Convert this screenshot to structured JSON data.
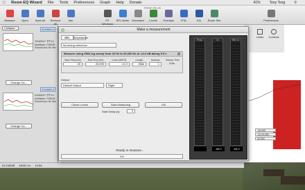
{
  "menubar": {
    "app": "Room EQ Wizard",
    "items": [
      "File",
      "Tools",
      "Preferences",
      "Graph",
      "Help",
      "Donate"
    ],
    "status": "Tony Teng",
    "battery": "41%"
  },
  "toolbar": {
    "title": "REW V5.18",
    "buttons": [
      {
        "label": "Measure",
        "color": "#d44"
      },
      {
        "label": "Open",
        "color": "#4a79c4"
      },
      {
        "label": "Save All",
        "color": "#4a79c4"
      },
      {
        "label": "Remove All",
        "color": "#c44"
      },
      {
        "label": "Info",
        "color": "#4a79c4"
      }
    ],
    "right": [
      {
        "label": "RT Windows",
        "color": "#555"
      },
      {
        "label": "SPL Meter",
        "color": "#3a7ed4"
      },
      {
        "label": "Generator",
        "color": "#888"
      },
      {
        "label": "Levels",
        "color": "#3a8a3a"
      },
      {
        "label": "Overlays",
        "color": "#6a6a9a"
      },
      {
        "label": "RTA",
        "color": "#3a6ac4"
      },
      {
        "label": "EQ",
        "color": "#2a5aa4"
      },
      {
        "label": "Room Sim",
        "color": "#4a8a6a"
      },
      {
        "label": "Preferences",
        "color": "#777"
      }
    ]
  },
  "left": {
    "collapse": "Collapse",
    "measurements": [
      {
        "date": "20180813",
        "info": [
          "2018/8/12 下午10:",
          "Mic/Meter: PSENR",
          "SoundCard: No Mic"
        ],
        "button": "Change Ca..."
      },
      {
        "date": "20180813",
        "info": [
          "2018/8/13 下午10:",
          "Mic/Meter: PSENR",
          "SoundCard: No Mic"
        ],
        "button": "Change Ca..."
      }
    ]
  },
  "side": {
    "limits": "Limits",
    "controls": "Controls"
  },
  "status": {
    "mem": "81/155MB",
    "rate": "48000 Hz",
    "bits": "16 Bit"
  },
  "readouts": [
    "-30.000",
    "-20.20,000",
    "20,000"
  ],
  "dialog": {
    "title": "Make a measurement",
    "tabs": [
      "SPL",
      "Impedance"
    ],
    "reference": "No timing reference",
    "sweep": {
      "header": "Measure using 256k log sweep from 20 Hz to 20,000 Hz at -12.0 dB taking 5.5 s",
      "fields": [
        {
          "label": "Start Freq (Hz)",
          "value": "20"
        },
        {
          "label": "End Freq (Hz)",
          "value": "20,000"
        },
        {
          "label": "Level (dBFS)",
          "value": "-12.0"
        },
        {
          "label": "Length",
          "value": "256k"
        },
        {
          "label": "Sweeps",
          "value": "1"
        },
        {
          "label": "Sweep Time",
          "value": "5.5s"
        }
      ]
    },
    "output_label": "Output",
    "output_device": "Default Output",
    "channel": "Right",
    "check_levels": "Check Levels",
    "start": "Start Measuring",
    "cancel": "Kill",
    "start_delay_label": "Start Delay (s)",
    "start_delay": "0",
    "message": "Ready to measure...",
    "progress": "0%",
    "meters": [
      {
        "label": "Peak",
        "value": "",
        "level": 0
      },
      {
        "label": "In",
        "value": "-99.0",
        "level": 0
      },
      {
        "label": "Ref. In",
        "value": "-99.0",
        "level": 0
      }
    ]
  }
}
